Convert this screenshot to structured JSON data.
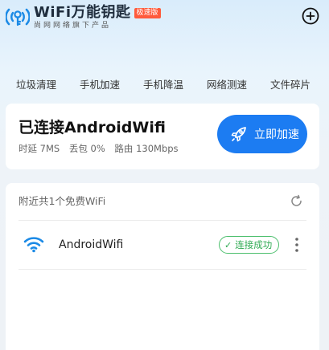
{
  "header": {
    "brand_name": "WiFi万能钥匙",
    "badge": "极速版",
    "slogan": "尚网网络旗下产品",
    "logo_icon": "wifi-key-logo-icon",
    "add_icon": "plus-circle-icon"
  },
  "tools": [
    "垃圾清理",
    "手机加速",
    "手机降温",
    "网络测速",
    "文件碎片"
  ],
  "connection": {
    "title": "已连接AndroidWifi",
    "latency": "时延 7MS",
    "packet_loss": "丢包 0%",
    "router": "路由 130Mbps",
    "speed_button": "立即加速",
    "speed_icon": "rocket-icon"
  },
  "nearby": {
    "heading": "附近共1个免费WiFi",
    "refresh_icon": "refresh-icon",
    "networks": [
      {
        "name": "AndroidWifi",
        "status": "连接成功",
        "icon": "wifi-icon"
      }
    ]
  },
  "colors": {
    "accent": "#1c7cf2",
    "success": "#2eaa52",
    "badge": "#ff5a3c",
    "wifi_icon": "#1b8ae6"
  }
}
